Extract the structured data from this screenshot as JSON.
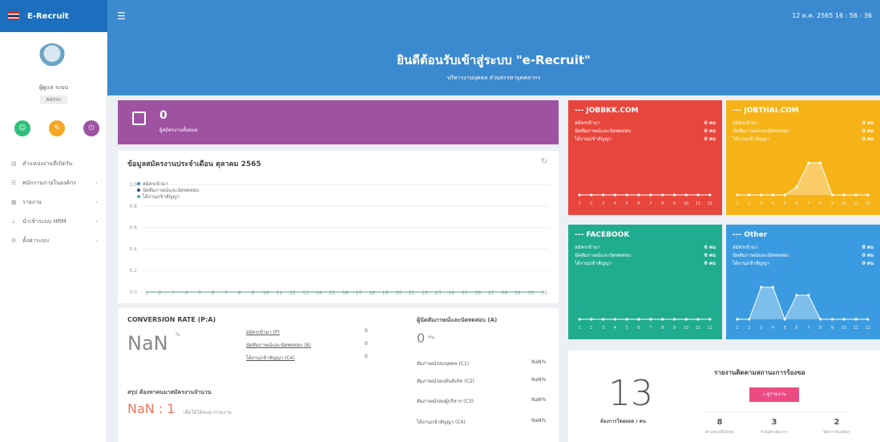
{
  "app": {
    "brand": "E-Recruit",
    "datetime": "12 ต.ค. 2565 16 : 56 : 36"
  },
  "sidebar": {
    "user_name": "ผู้ดูแล ระบบ",
    "user_role": "Admin",
    "shortcut_colors": [
      "#2ebf7a",
      "#f5a623",
      "#9d53a2"
    ],
    "items": [
      {
        "label": "คำแหน่งงานที่เปิดรับ",
        "icon": "list-icon",
        "has_children": false
      },
      {
        "label": "พนักงานภายในองค์กร",
        "icon": "users-icon",
        "has_children": true
      },
      {
        "label": "รายงาน",
        "icon": "report-icon",
        "has_children": true
      },
      {
        "label": "นำเข้าระบบ HRM",
        "icon": "import-icon",
        "has_children": true
      },
      {
        "label": "ตั้งค่าระบบ",
        "icon": "gear-icon",
        "has_children": true
      }
    ]
  },
  "hero": {
    "title": "ยินดีต้อนรับเข้าสู่ระบบ \"e-Recruit\"",
    "subtitle": "บริหารงานบุคคล ส่วนสรรหาบุคคลากร"
  },
  "applicants": {
    "count": "0",
    "label": "ผู้สมัครงานทั้งหมด"
  },
  "monthly": {
    "title": "ข้อมูลสมัครงานประจำเดือน ตุลาคม 2565"
  },
  "chart_data": {
    "type": "line",
    "x": [
      1,
      2,
      3,
      4,
      5,
      6,
      7,
      8,
      9,
      10,
      11,
      12,
      13,
      14,
      15,
      16,
      17,
      18,
      19,
      20,
      21,
      22,
      23,
      24,
      25,
      26,
      27,
      28,
      29,
      30,
      31
    ],
    "series": [
      {
        "name": "สมัครเข้ามา",
        "color": "#3b8ad0",
        "values": [
          0,
          0,
          0,
          0,
          0,
          0,
          0,
          0,
          0,
          0,
          0,
          0,
          0,
          0,
          0,
          0,
          0,
          0,
          0,
          0,
          0,
          0,
          0,
          0,
          0,
          0,
          0,
          0,
          0,
          0,
          0
        ]
      },
      {
        "name": "นัดสัมภาษณ์และนัดทดสอบ",
        "color": "#2d4a6e",
        "values": [
          0,
          0,
          0,
          0,
          0,
          0,
          0,
          0,
          0,
          0,
          0,
          0,
          0,
          0,
          0,
          0,
          0,
          0,
          0,
          0,
          0,
          0,
          0,
          0,
          0,
          0,
          0,
          0,
          0,
          0,
          0
        ]
      },
      {
        "name": "ได้งาน/เข้าสัญญา",
        "color": "#2ebf7a",
        "values": [
          0,
          0,
          0,
          0,
          0,
          0,
          0,
          0,
          0,
          0,
          0,
          0,
          0,
          0,
          0,
          0,
          0,
          0,
          0,
          0,
          0,
          0,
          0,
          0,
          0,
          0,
          0,
          0,
          0,
          0,
          0
        ]
      }
    ],
    "y_ticks": [
      "1.0",
      "0.8",
      "0.6",
      "0.4",
      "0.2",
      "0.0"
    ],
    "ylim": [
      0,
      1
    ],
    "grid": true,
    "legend": "top-left"
  },
  "conversion": {
    "title": "CONVERSION RATE (P:A)",
    "value": "NaN",
    "unit": "%",
    "rows": [
      {
        "label": "สมัครเข้ามา (P)",
        "value": "0"
      },
      {
        "label": "นัดสัมภาษณ์และนัดทดสอบ (A)",
        "value": "0"
      },
      {
        "label": "ได้งาน/เข้าสัญญา (C4)",
        "value": "0"
      }
    ]
  },
  "summary_small": {
    "title": "สรุป ต้องหาคนมาสมัครงานจำนวน",
    "value": "NaN : 1",
    "note": "เพื่อให้ได้คนมาร่วมงาน"
  },
  "interview": {
    "title": "ผู้นัดสัมภาษณ์และนัดทดสอบ (A)",
    "count": "0",
    "unit": "คน",
    "rows": [
      {
        "label": "สัมภาษณ์รอบบุคคล (C1)",
        "value": "NaN%"
      },
      {
        "label": "สัมภาษณ์รอบต้นสังกัด (C2)",
        "value": "NaN%"
      },
      {
        "label": "สัมภาษณ์รอบผู้บริหาร (C3)",
        "value": "NaN%"
      },
      {
        "label": "ได้งาน/เข้าสัญญา (C4)",
        "value": "NaN%"
      }
    ]
  },
  "sources": [
    {
      "title": "--- JOBBKK.COM",
      "color": "#e8453c",
      "rows": [
        {
          "label": "สมัครเข้ามา",
          "value": "0 คน"
        },
        {
          "label": "นัดสัมภาษณ์และนัดทดสอบ",
          "value": "0 คน"
        },
        {
          "label": "ได้งาน/เข้าสัญญา",
          "value": "0 คน"
        }
      ],
      "trend": [
        0,
        0,
        0,
        0,
        0,
        0,
        0,
        0,
        0,
        0,
        0,
        0
      ]
    },
    {
      "title": "--- JOBTHAI.COM",
      "color": "#f5b317",
      "rows": [
        {
          "label": "สมัครเข้ามา",
          "value": "4 คน"
        },
        {
          "label": "นัดสัมภาษณ์และนัดทดสอบ",
          "value": "0 คน"
        },
        {
          "label": "ได้งาน/เข้าสัญญา",
          "value": "0 คน"
        }
      ],
      "trend": [
        0,
        0,
        0,
        0,
        0,
        1,
        4,
        4,
        0,
        0,
        0,
        0
      ]
    },
    {
      "title": "--- FACEBOOK",
      "color": "#1fac8f",
      "rows": [
        {
          "label": "สมัครเข้ามา",
          "value": "0 คน"
        },
        {
          "label": "นัดสัมภาษณ์และนัดทดสอบ",
          "value": "0 คน"
        },
        {
          "label": "ได้งาน/เข้าสัญญา",
          "value": "0 คน"
        }
      ],
      "trend": [
        0,
        0,
        0,
        0,
        0,
        0,
        0,
        0,
        0,
        0,
        0,
        0
      ]
    },
    {
      "title": "--- Other",
      "color": "#3a9be0",
      "rows": [
        {
          "label": "สมัครเข้ามา",
          "value": "8 คน"
        },
        {
          "label": "นัดสัมภาษณ์และนัดทดสอบ",
          "value": "0 คน"
        },
        {
          "label": "ได้งาน/เข้าสัญญา",
          "value": "0 คน"
        }
      ],
      "trend": [
        0,
        0,
        4,
        4,
        0,
        3,
        3,
        0,
        0,
        0,
        0,
        0
      ]
    }
  ],
  "requests": {
    "big_number": "13",
    "big_label": "ต้องการโดยยอด / คน",
    "title": "รายงานติดตามสถานะการร้องขอ",
    "button": "ดูรายงาน",
    "stats": [
      {
        "value": "8",
        "label": "ตำแหน่งที่เปิดรับ"
      },
      {
        "value": "3",
        "label": "กำลังดำเนินการ"
      },
      {
        "value": "2",
        "label": "ปิดการรับสมัคร"
      }
    ]
  }
}
